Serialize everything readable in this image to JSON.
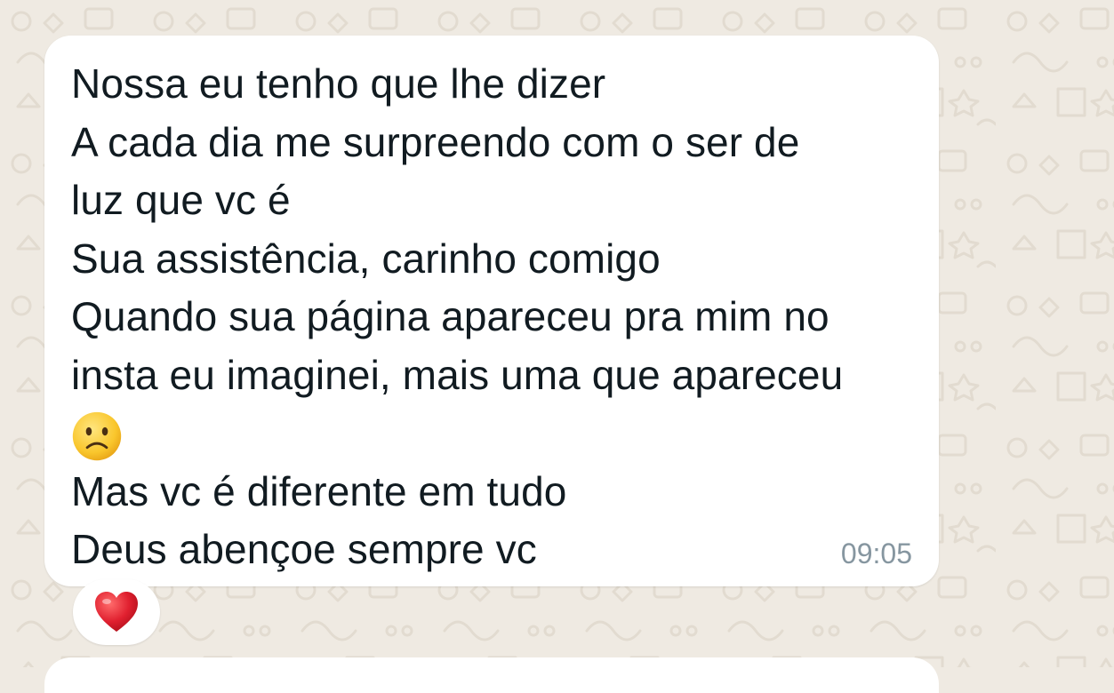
{
  "chat": {
    "wallpaper_color": "#efeae2",
    "bubble_color": "#ffffff",
    "message": {
      "lines": [
        "Nossa eu tenho que lhe dizer",
        "A cada dia me surpreendo com o ser de",
        "luz que vc é",
        "Sua assistência, carinho comigo",
        "Quando sua página apareceu pra mim no",
        "insta eu imaginei, mais uma que apareceu"
      ],
      "emoji": "slightly-frowning-face-emoji",
      "lines_after_emoji": [
        "Mas vc é diferente em tudo",
        "Deus abençoe sempre vc"
      ],
      "time": "09:05"
    },
    "reaction": {
      "icon": "red-heart-icon",
      "color": "#e0202f"
    }
  }
}
